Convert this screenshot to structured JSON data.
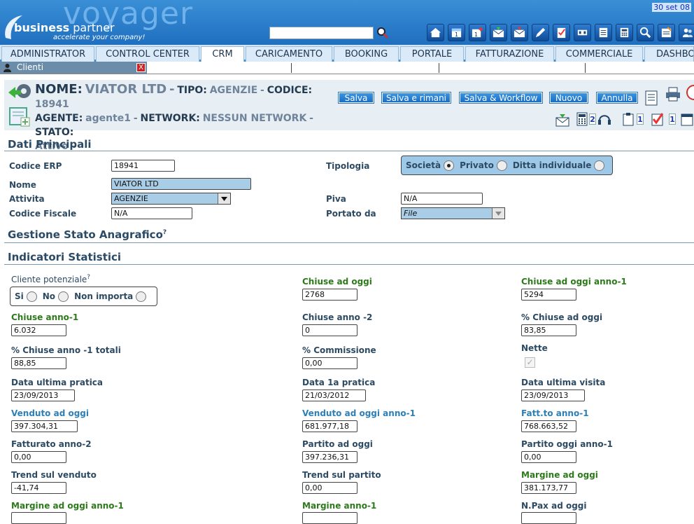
{
  "brand": {
    "name": "voyager",
    "company_bold": "business",
    "company_light": " partner",
    "tagline": "accelerate your company!",
    "accent": "#1f6fbf"
  },
  "date": "30 set 08",
  "search": {
    "value": ""
  },
  "toolbar_icons": [
    "home-icon",
    "calendar-icon",
    "calendar-add-icon",
    "mail-icon",
    "mail-alert-icon",
    "pen-icon",
    "checklist-icon",
    "tools-icon",
    "list-icon",
    "calculator-icon",
    "magnifier-icon",
    "notes-icon",
    "users-icon"
  ],
  "menu": [
    "ADMINISTRATOR",
    "CONTROL CENTER",
    "CRM",
    "CARICAMENTO",
    "BOOKING",
    "PORTALE",
    "FATTURAZIONE",
    "COMMERCIALE",
    "DASHBOA"
  ],
  "tab": {
    "label": "Clienti",
    "close": "X"
  },
  "record": {
    "nome_label": "NOME:",
    "nome": "VIATOR LTD",
    "tipo_label": "TIPO:",
    "tipo": "AGENZIE",
    "codice_label": "CODICE:",
    "codice": "18941",
    "agente_label": "AGENTE:",
    "agente": "agente1",
    "network_label": "NETWORK:",
    "network": "NESSUN NETWORK",
    "stato_label": "STATO:",
    "stato": "Attivo",
    "dash": "-"
  },
  "buttons": {
    "salva": "Salva",
    "salva_rimani": "Salva e rimani",
    "salva_workflow": "Salva & Workflow",
    "nuovo": "Nuovo",
    "annulla": "Annulla"
  },
  "counters": {
    "a": "2",
    "b": "1",
    "c": "1"
  },
  "dati": {
    "title": "Dati Principali",
    "codice_erp_label": "Codice ERP",
    "codice_erp": "18941",
    "nome_label": "Nome",
    "nome": "VIATOR LTD",
    "attivita_label": "Attivita",
    "attivita": "AGENZIE",
    "codice_fiscale_label": "Codice Fiscale",
    "codice_fiscale": "N/A",
    "tipologia_label": "Tipologia",
    "tipologia_options": [
      "Società",
      "Privato",
      "Ditta individuale"
    ],
    "tipologia_selected": "Società",
    "piva_label": "Piva",
    "piva": "N/A",
    "portato_label": "Portato da",
    "portato": "File"
  },
  "gestione_title": "Gestione Stato Anagrafico",
  "help": "?",
  "indicatori": {
    "title": "Indicatori Statistici",
    "cliente_potenziale_label": "Cliente potenziale",
    "cliente_options": [
      "Si",
      "No",
      "Non importa"
    ],
    "fields": [
      {
        "label": "Chiuse ad oggi",
        "value": "2768"
      },
      {
        "label": "Chiuse ad oggi anno-1",
        "value": "5294"
      },
      {
        "label": "Chiuse anno-1",
        "value": "6.032"
      },
      {
        "label": "Chiuse anno -2",
        "value": "0"
      },
      {
        "label": "% Chiuse ad oggi",
        "value": "83,85"
      },
      {
        "label": "% Chiuse anno -1 totali",
        "value": "88,85"
      },
      {
        "label": "% Commissione",
        "value": "0,00"
      },
      {
        "label": "Nette",
        "value": "✓"
      },
      {
        "label": "Data ultima pratica",
        "value": "23/09/2013"
      },
      {
        "label": "Data 1a pratica",
        "value": "21/03/2012"
      },
      {
        "label": "Data ultima visita",
        "value": "23/09/2013"
      },
      {
        "label": "Venduto ad oggi",
        "value": "397.304,31"
      },
      {
        "label": "Venduto ad oggi anno-1",
        "value": "681.977,18"
      },
      {
        "label": "Fatt.to anno-1",
        "value": "768.663,52"
      },
      {
        "label": "Fatturato anno-2",
        "value": "0,00"
      },
      {
        "label": "Partito ad oggi",
        "value": "397.236,31"
      },
      {
        "label": "Partito oggi anno-1",
        "value": "0,00"
      },
      {
        "label": "Trend sul venduto",
        "value": "-41,74"
      },
      {
        "label": "Trend sul partito",
        "value": "0,00"
      },
      {
        "label": "Margine ad oggi",
        "value": "381.173,77"
      },
      {
        "label": "Margine ad oggi anno-1",
        "value": ""
      },
      {
        "label": "Margine anno-1",
        "value": ""
      },
      {
        "label": "N.Pax ad oggi",
        "value": ""
      }
    ]
  }
}
